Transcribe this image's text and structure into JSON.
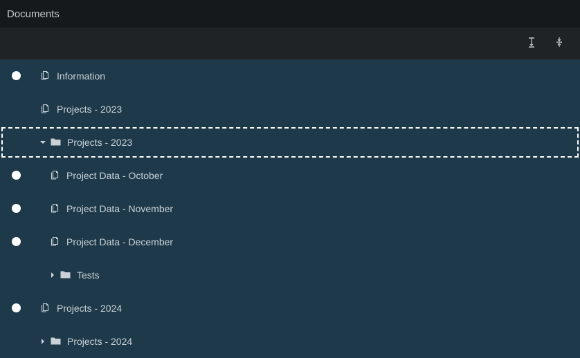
{
  "window": {
    "title": "Documents"
  },
  "toolbar": {
    "expand_icon": "expand-vertical-icon",
    "collapse_icon": "collapse-vertical-icon"
  },
  "tree": {
    "items": [
      {
        "label": "Information",
        "type": "document",
        "depth": 0,
        "has_radio": true
      },
      {
        "label": "Projects - 2023",
        "type": "document",
        "depth": 0,
        "has_radio": false
      },
      {
        "label": "Projects - 2023",
        "type": "folder",
        "depth": 0,
        "expanded": true,
        "focused": true,
        "has_radio": false
      },
      {
        "label": "Project Data - October",
        "type": "document",
        "depth": 1,
        "has_radio": true
      },
      {
        "label": "Project Data - November",
        "type": "document",
        "depth": 1,
        "has_radio": true
      },
      {
        "label": "Project Data - December",
        "type": "document",
        "depth": 1,
        "has_radio": true
      },
      {
        "label": "Tests",
        "type": "folder",
        "depth": 1,
        "expanded": false,
        "has_radio": false
      },
      {
        "label": "Projects - 2024",
        "type": "document",
        "depth": 0,
        "has_radio": true
      },
      {
        "label": "Projects - 2024",
        "type": "folder",
        "depth": 0,
        "expanded": false,
        "has_radio": false
      }
    ]
  },
  "colors": {
    "titlebar": "#16191c",
    "toolbar": "#202325",
    "tree_bg": "#1e3a4a",
    "text": "#c9d2d8"
  }
}
